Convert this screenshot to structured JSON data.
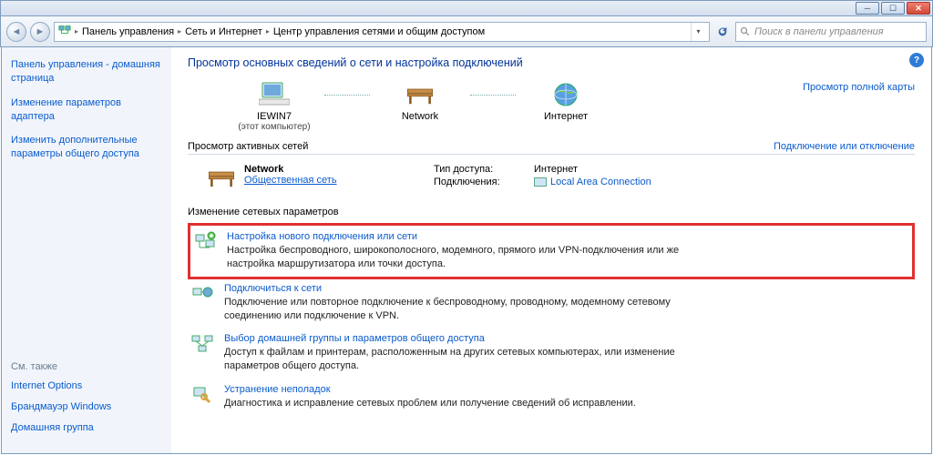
{
  "window": {
    "min": "_",
    "max": "☐",
    "close": "X"
  },
  "breadcrumb": {
    "cp": "Панель управления",
    "net": "Сеть и Интернет",
    "center": "Центр управления сетями и общим доступом"
  },
  "search": {
    "placeholder": "Поиск в панели управления"
  },
  "sidebar": {
    "home": "Панель управления - домашняя страница",
    "adapter": "Изменение параметров адаптера",
    "sharing": "Изменить дополнительные параметры общего доступа",
    "see_also": "См. также",
    "internet_options": "Internet Options",
    "firewall": "Брандмауэр Windows",
    "homegroup": "Домашняя группа"
  },
  "content": {
    "title": "Просмотр основных сведений о сети и настройка подключений",
    "map": {
      "pc": "IEWIN7",
      "pc_sub": "(этот компьютер)",
      "network": "Network",
      "internet": "Интернет",
      "full_map": "Просмотр полной карты"
    },
    "active_header": "Просмотр активных сетей",
    "connect_disconnect": "Подключение или отключение",
    "active": {
      "name": "Network",
      "type": "Общественная сеть",
      "access_type_k": "Тип доступа:",
      "access_type_v": "Интернет",
      "connections_k": "Подключения:",
      "connections_v": "Local Area Connection"
    },
    "tasks_header": "Изменение сетевых параметров",
    "tasks": [
      {
        "title": "Настройка нового подключения или сети",
        "desc": "Настройка беспроводного, широкополосного, модемного, прямого или VPN-подключения или же настройка маршрутизатора или точки доступа."
      },
      {
        "title": "Подключиться к сети",
        "desc": "Подключение или повторное подключение к беспроводному, проводному, модемному сетевому соединению или подключение к VPN."
      },
      {
        "title": "Выбор домашней группы и параметров общего доступа",
        "desc": "Доступ к файлам и принтерам, расположенным на других сетевых компьютерах, или изменение параметров общего доступа."
      },
      {
        "title": "Устранение неполадок",
        "desc": "Диагностика и исправление сетевых проблем или получение сведений об исправлении."
      }
    ]
  }
}
